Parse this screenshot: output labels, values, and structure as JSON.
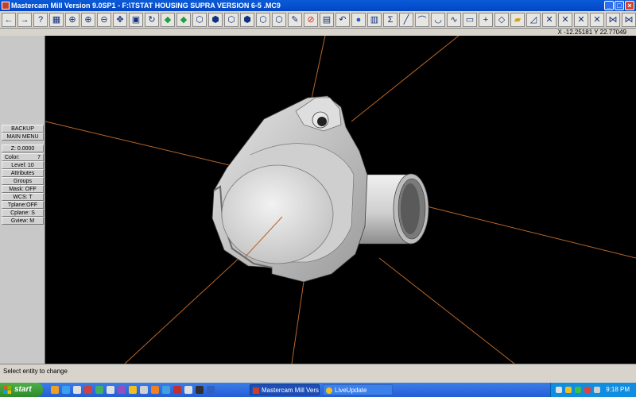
{
  "window": {
    "title": "Mastercam Mill Version 9.0SP1 - F:\\TSTAT HOUSING SUPRA VERSION 6-5 .MC9",
    "min_label": "_",
    "max_label": "□",
    "close_label": "×"
  },
  "toolbar": {
    "icons": [
      "arrow-left-icon",
      "arrow-right-icon",
      "help-icon",
      "calculator-icon",
      "zoom-window-icon",
      "zoom-icon",
      "unzoom-icon",
      "pan-icon",
      "screen-icon",
      "regen-icon",
      "shade-icon",
      "shade-icon",
      "iso-view-icon",
      "top-view-icon",
      "front-view-icon",
      "side-view-icon",
      "iso-view-icon",
      "cube-view-icon",
      "pencil-icon",
      "no-entry-icon",
      "multi-view-icon",
      "undo-icon",
      "sphere-icon",
      "layers-icon",
      "sigma-icon",
      "line-icon",
      "arc-icon",
      "curve-icon",
      "spline-icon",
      "rectangle-icon",
      "point-icon",
      "surface-icon",
      "solid-icon",
      "chamfer-icon",
      "trim-icon",
      "trim-icon",
      "trim-icon",
      "trim-icon",
      "break-icon",
      "break-icon",
      "toolpath-icon",
      "tools-icon"
    ],
    "accent": "#103080"
  },
  "coords": {
    "readout": "X -12.25181  Y 22.77049"
  },
  "menu": {
    "backup": "BACKUP",
    "main_menu": "MAIN MENU",
    "z": "Z:  0.0000",
    "color_label": "Color:",
    "color_value": "7",
    "level": "Level: 10",
    "attributes": "Attributes",
    "groups": "Groups",
    "mask": "Mask:  OFF",
    "wcs": "WCS:   T",
    "tplane": "Tplane:OFF",
    "cplane": "Cplane:  S",
    "gview": "Gview:   M"
  },
  "viewport": {
    "background": "#000000",
    "axis_color": "#b8662a",
    "part_color": "#d8d8d8"
  },
  "prompt": {
    "text": "Select entity to change"
  },
  "taskbar": {
    "start_label": "start",
    "tasks": [
      {
        "label": "Mastercam Mill Versio...",
        "active": true
      },
      {
        "label": "LiveUpdate",
        "active": false
      }
    ],
    "clock": "9:18 PM"
  }
}
